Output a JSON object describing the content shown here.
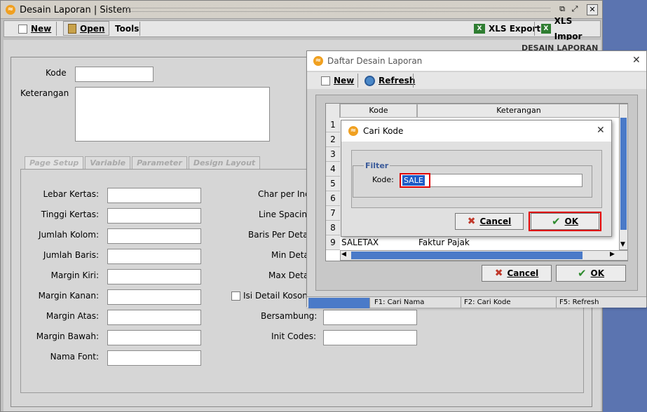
{
  "main": {
    "title": "Desain Laporan | Sistem",
    "toolbar": {
      "new_label": "New",
      "open_label": "Open",
      "tools_label": "Tools",
      "xls_export_label": "XLS Export",
      "xls_import_label": "XLS Impor",
      "xls_icon": "X"
    },
    "section_heading": "DESAIN LAPORAN",
    "kode_label": "Kode",
    "keterangan_label": "Keterangan",
    "tabs": [
      {
        "label": "Page Setup"
      },
      {
        "label": "Variable"
      },
      {
        "label": "Parameter"
      },
      {
        "label": "Design Layout"
      }
    ],
    "left_fields": [
      {
        "label": "Lebar Kertas:"
      },
      {
        "label": "Tinggi Kertas:"
      },
      {
        "label": "Jumlah Kolom:"
      },
      {
        "label": "Jumlah Baris:"
      },
      {
        "label": "Margin Kiri:"
      },
      {
        "label": "Margin Kanan:"
      },
      {
        "label": "Margin Atas:"
      },
      {
        "label": "Margin Bawah:"
      },
      {
        "label": "Nama Font:"
      }
    ],
    "right_fields": [
      {
        "label": "Char per Inc"
      },
      {
        "label": "Line Spacin"
      },
      {
        "label": "Baris Per Deta"
      },
      {
        "label": "Min Deta"
      },
      {
        "label": "Max Deta"
      },
      {
        "label": "Isi Detail Koson"
      },
      {
        "label": "Bersambung:"
      },
      {
        "label": "Init Codes:"
      }
    ]
  },
  "daftar": {
    "title": "Daftar Desain Laporan",
    "new_label": "New",
    "refresh_label": "Refresh",
    "grid": {
      "headers": [
        "Kode",
        "Keterangan"
      ],
      "row_numbers": [
        "1",
        "2",
        "3",
        "4",
        "5",
        "6",
        "7",
        "8",
        "9"
      ],
      "last_row": {
        "kode": "SALETAX",
        "keterangan": "Faktur Pajak"
      }
    },
    "cancel_label": "Cancel",
    "ok_label": "OK",
    "status": {
      "f1": "F1: Cari Nama",
      "f2": "F2: Cari Kode",
      "f5": "F5: Refresh"
    }
  },
  "cari": {
    "title": "Cari Kode",
    "filter_group": "Filter",
    "kode_label": "Kode:",
    "kode_value": "SALE",
    "cancel_label": "Cancel",
    "ok_label": "OK"
  },
  "icons": {
    "app_logo": "app-logo-icon",
    "close": "close-icon",
    "restore": "restore-icon",
    "maximize": "maximize-icon"
  }
}
